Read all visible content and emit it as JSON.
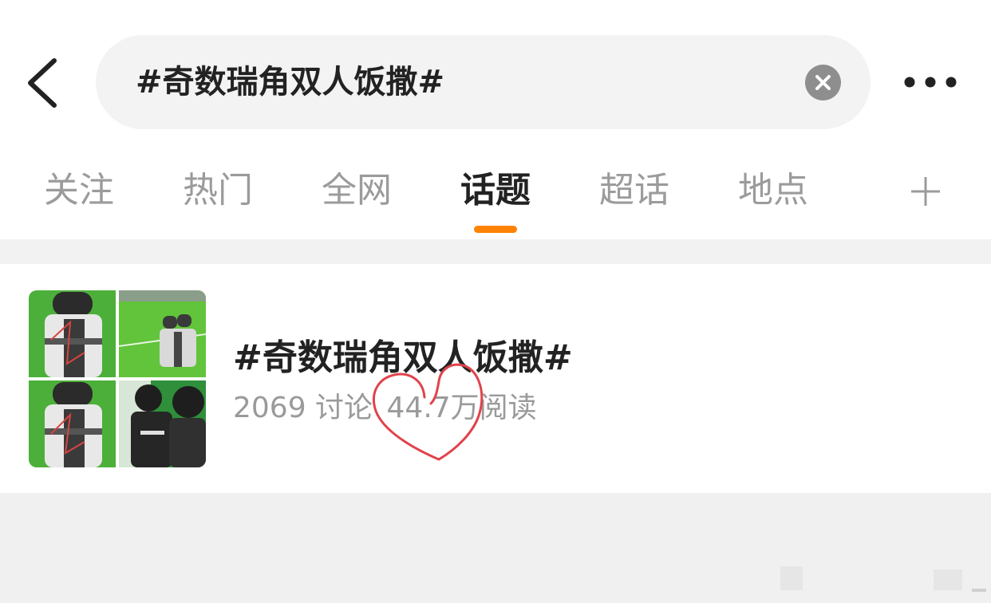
{
  "header": {
    "search_query": "#奇数瑞角双人饭撒#"
  },
  "tabs": [
    {
      "label": "关注",
      "active": false
    },
    {
      "label": "热门",
      "active": false
    },
    {
      "label": "全网",
      "active": false
    },
    {
      "label": "话题",
      "active": true
    },
    {
      "label": "超话",
      "active": false
    },
    {
      "label": "地点",
      "active": false
    }
  ],
  "topic": {
    "title": "#奇数瑞角双人饭撒#",
    "discussions": "2069 讨论",
    "reads": "44.7万阅读"
  },
  "colors": {
    "accent": "#ff8200",
    "text_primary": "#222222",
    "text_secondary": "#9a9a9a",
    "annotation": "#e0434b"
  },
  "icons": {
    "back": "chevron-left-icon",
    "clear": "close-icon",
    "more": "more-dots-icon",
    "add_tab": "plus-icon"
  }
}
